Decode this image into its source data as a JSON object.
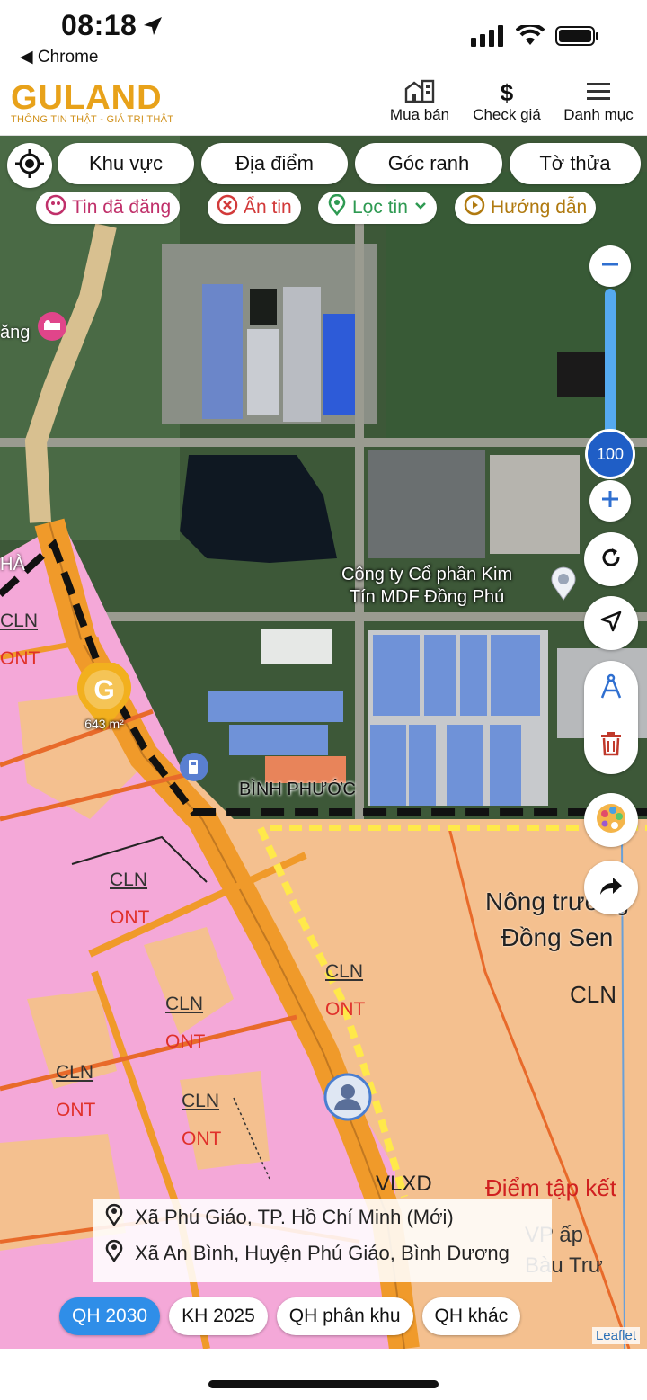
{
  "status_bar": {
    "time": "08:18",
    "back_app": "◀ Chrome"
  },
  "header": {
    "logo_word": "GULAND",
    "logo_tagline": "THÔNG TIN THẬT - GIÁ TRỊ THẬT",
    "actions": [
      {
        "label": "Mua bán",
        "icon": "building-icon"
      },
      {
        "label": "Check giá",
        "icon": "dollar-icon"
      },
      {
        "label": "Danh mục",
        "icon": "menu-icon"
      }
    ]
  },
  "filters": [
    "Khu vực",
    "Địa điểm",
    "Góc ranh",
    "Tờ thửa"
  ],
  "chips": [
    {
      "label": "Tin đã đăng",
      "color": "#c0306a"
    },
    {
      "label": "Ẩn tin",
      "color": "#d23a3a"
    },
    {
      "label": "Lọc tin",
      "color": "#2e9a52"
    },
    {
      "label": "Hướng dẫn",
      "color": "#b07a10"
    }
  ],
  "zoom": {
    "level": "100",
    "fill_fraction": 0.72
  },
  "map_labels": {
    "company": "Công ty Cổ phần Kim Tín MDF Đồng Phú",
    "company_line1": "Công ty Cổ phần Kim",
    "company_line2": "Tín MDF Đồng Phú",
    "province": "BÌNH PHƯỚC",
    "farm_line1": "Nông trường",
    "farm_line2": "Đồng Sen",
    "hang": "ăng",
    "ha": "HÀ",
    "cln": "CLN",
    "ont": "ONT",
    "vlxd": "VLXD",
    "diem_tap_ket": "Điểm tập kết",
    "ap_line1": "VP ấp",
    "ap_line2": "Bàu Trư",
    "listing_area": "643 m²"
  },
  "locations": [
    "Xã Phú Giáo, TP. Hồ Chí Minh (Mới)",
    "Xã An Bình, Huyện Phú Giáo, Bình Dương"
  ],
  "plan_tabs": [
    {
      "label": "QH 2030",
      "active": true
    },
    {
      "label": "KH 2025",
      "active": false
    },
    {
      "label": "QH phân khu",
      "active": false
    },
    {
      "label": "QH khác",
      "active": false
    }
  ],
  "attribution": "Leaflet",
  "colors": {
    "accent": "#2f8ee8",
    "brand": "#e8a21a",
    "residential": "#f4a8d8",
    "farmland": "#f4c08f",
    "road": "#f09a2a"
  }
}
